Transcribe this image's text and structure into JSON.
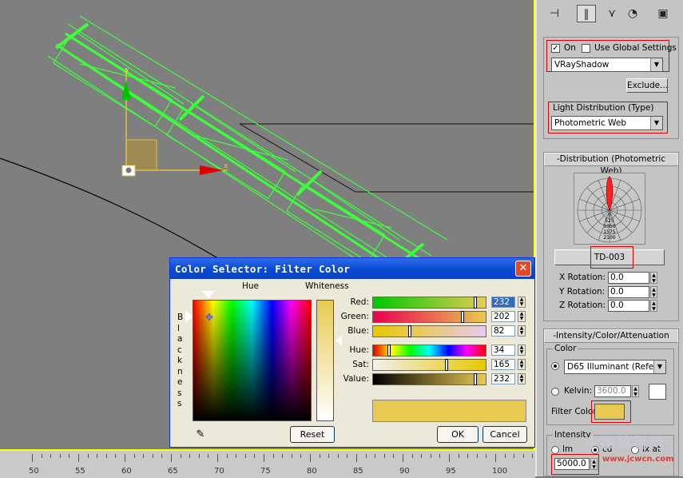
{
  "viewport": {
    "axis_labels": {
      "x": "x",
      "y": "y"
    }
  },
  "timeline": {
    "ticks": [
      "50",
      "55",
      "60",
      "65",
      "70",
      "75",
      "80",
      "85",
      "90",
      "95",
      "100"
    ]
  },
  "command_panel": {
    "toolbar_icons": [
      "create-icon",
      "modify-icon",
      "hierarchy-icon",
      "motion-icon",
      "display-icon",
      "utilities-icon"
    ],
    "shadows": {
      "on_label": "On",
      "on_checked": true,
      "use_global_label": "Use Global Settings",
      "use_global_checked": false,
      "shadow_type": "VRayShadow",
      "exclude_label": "Exclude..."
    },
    "light_distribution": {
      "label": "Light Distribution (Type)",
      "value": "Photometric Web"
    },
    "photometric_web": {
      "title": "Distribution (Photometric Web)",
      "web_ticks": [
        "0",
        "525",
        "1050",
        "1575",
        "2100"
      ],
      "file_button": "TD-003",
      "x_rotation_label": "X Rotation:",
      "x_rotation": "0.0",
      "y_rotation_label": "Y Rotation:",
      "y_rotation": "0.0",
      "z_rotation_label": "Z Rotation:",
      "z_rotation": "0.0"
    },
    "intensity": {
      "title": "Intensity/Color/Attenuation",
      "color_group": "Color",
      "preset": "D65 Illuminant (Refere",
      "kelvin_label": "Kelvin:",
      "kelvin": "3600.0",
      "filter_color_label": "Filter Color",
      "filter_color": "#e8ca52",
      "intensity_group": "Intensity",
      "lm_label": "lm",
      "cd_label": "cd",
      "lx_label": "lx at",
      "intensity_value": "5000.0"
    }
  },
  "dialog": {
    "title": "Color Selector: Filter Color",
    "hue_label": "Hue",
    "whiteness_label": "Whiteness",
    "blackness_letters": [
      "B",
      "l",
      "a",
      "c",
      "k",
      "n",
      "e",
      "s",
      "s"
    ],
    "channels": [
      {
        "label": "Red:",
        "value": "232",
        "fraction": 0.91
      },
      {
        "label": "Green:",
        "value": "202",
        "fraction": 0.79
      },
      {
        "label": "Blue:",
        "value": "82",
        "fraction": 0.32
      },
      {
        "label": "Hue:",
        "value": "34",
        "fraction": 0.13
      },
      {
        "label": "Sat:",
        "value": "165",
        "fraction": 0.65
      },
      {
        "label": "Value:",
        "value": "232",
        "fraction": 0.91
      }
    ],
    "swatch_color": "#e8ca52",
    "reset_label": "Reset",
    "ok_label": "OK",
    "cancel_label": "Cancel"
  },
  "watermark": {
    "chinese": "中国教程网",
    "url": "www.jcwcn.com"
  }
}
